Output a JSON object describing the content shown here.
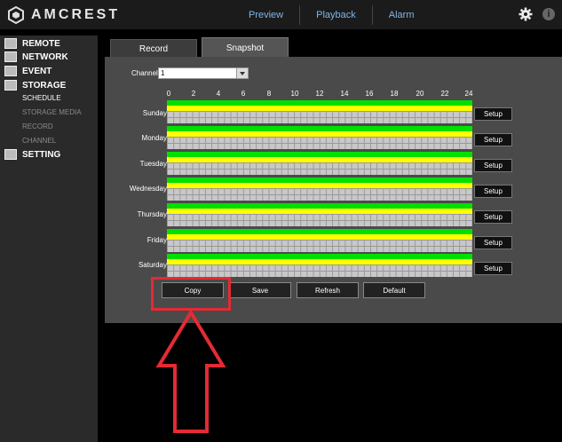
{
  "brand": {
    "name": "AMCREST"
  },
  "nav": {
    "items": [
      "Preview",
      "Playback",
      "Alarm"
    ]
  },
  "sidebar": {
    "remote": "REMOTE",
    "network": "NETWORK",
    "event": "EVENT",
    "storage": "STORAGE",
    "sub": [
      "SCHEDULE",
      "STORAGE MEDIA",
      "RECORD",
      "CHANNEL"
    ],
    "setting": "SETTING"
  },
  "tabs": {
    "record": "Record",
    "snapshot": "Snapshot"
  },
  "channel": {
    "label": "Channel",
    "value": "1"
  },
  "hours": [
    "0",
    "2",
    "4",
    "6",
    "8",
    "10",
    "12",
    "14",
    "16",
    "18",
    "20",
    "22",
    "24"
  ],
  "days": [
    "Sunday",
    "Monday",
    "Tuesday",
    "Wednesday",
    "Thursday",
    "Friday",
    "Saturday"
  ],
  "setup_label": "Setup",
  "actions": {
    "copy": "Copy",
    "save": "Save",
    "refresh": "Refresh",
    "default": "Default"
  },
  "colors": {
    "schedule_green": "#00e000",
    "schedule_yellow": "#ffff00",
    "highlight_red": "#e52a34",
    "nav_link": "#7fb6e8"
  },
  "icons": {
    "gear": "gear-icon",
    "info": "info-icon"
  }
}
